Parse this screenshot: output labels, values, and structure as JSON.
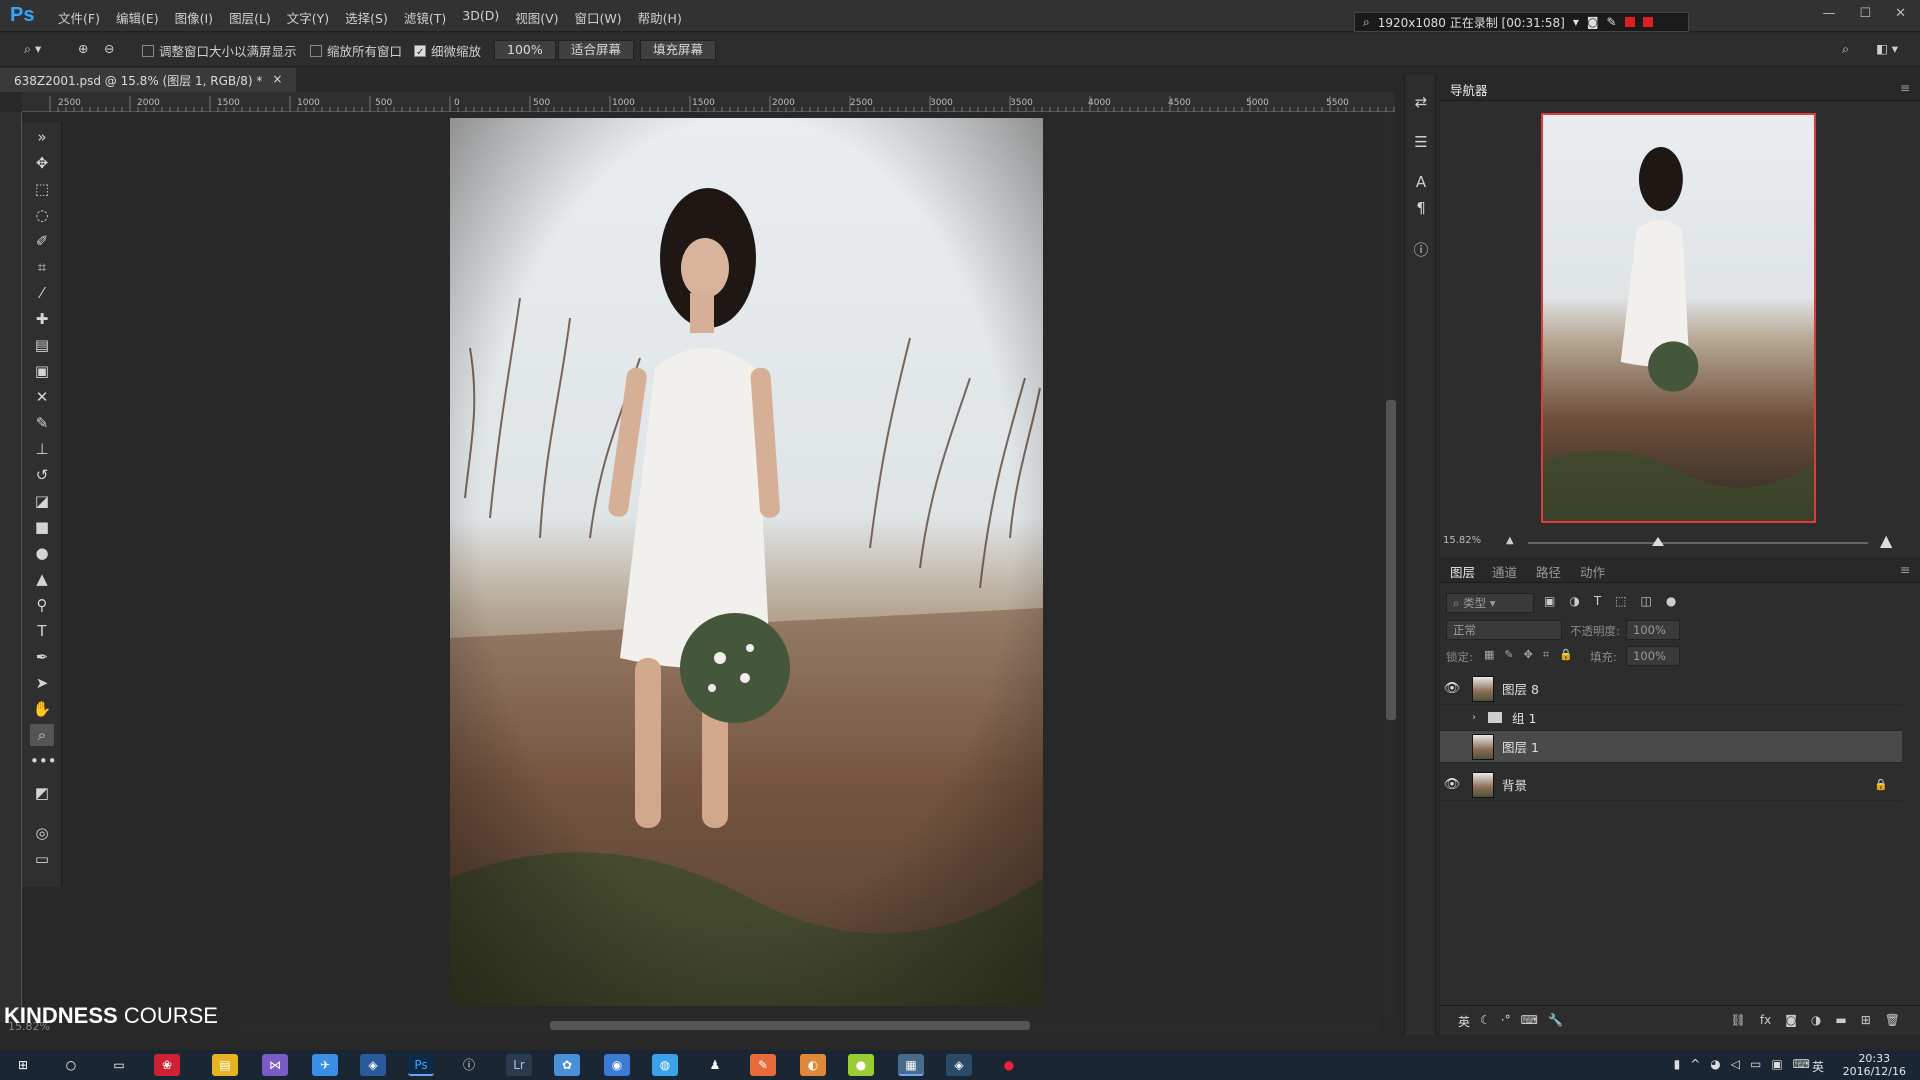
{
  "app": {
    "logo": "Ps",
    "menu": [
      "文件(F)",
      "编辑(E)",
      "图像(I)",
      "图层(L)",
      "文字(Y)",
      "选择(S)",
      "滤镜(T)",
      "3D(D)",
      "视图(V)",
      "窗口(W)",
      "帮助(H)"
    ],
    "recorder_text": "1920x1080  正在录制 [00:31:58]"
  },
  "options": {
    "resize_windows": "调整窗口大小以满屏显示",
    "zoom_all": "缩放所有窗口",
    "scrubby_zoom": "细微缩放",
    "zoom_value": "100%",
    "fit_screen": "适合屏幕",
    "fill_screen": "填充屏幕"
  },
  "document": {
    "tab_title": "638Z2001.psd @ 15.8% (图层 1, RGB/8) *",
    "close": "×",
    "status": "15.82%"
  },
  "ruler": [
    "2500",
    "2000",
    "1500",
    "1000",
    "500",
    "0",
    "500",
    "1000",
    "1500",
    "2000",
    "2500",
    "3000",
    "3500",
    "4000",
    "4500",
    "5000",
    "5500"
  ],
  "navigator": {
    "tab": "导航器",
    "zoom": "15.82%"
  },
  "layers_panel": {
    "tabs": [
      "图层",
      "通道",
      "路径",
      "动作"
    ],
    "filter": "类型",
    "blend": "正常",
    "opacity_label": "不透明度:",
    "opacity_value": "100%",
    "lock_label": "锁定:",
    "fill_label": "填充:",
    "fill_value": "100%",
    "layers": [
      {
        "name": "图层 8",
        "visible": true,
        "type": "layer"
      },
      {
        "name": "组 1",
        "visible": false,
        "type": "group"
      },
      {
        "name": "图层 1",
        "visible": false,
        "type": "layer",
        "selected": true
      },
      {
        "name": "背景",
        "visible": true,
        "type": "background",
        "locked": true
      }
    ]
  },
  "watermark": {
    "brand_bold": "KINDNESS",
    "brand_rest": "COURSE"
  },
  "taskbar": {
    "time": "20:33",
    "date": "2016/12/16",
    "ime": "英"
  },
  "colors": {
    "ps_blue": "#31a8ff",
    "nav_frame": "#e23a3a",
    "panel_bg": "#2d2d2d"
  }
}
